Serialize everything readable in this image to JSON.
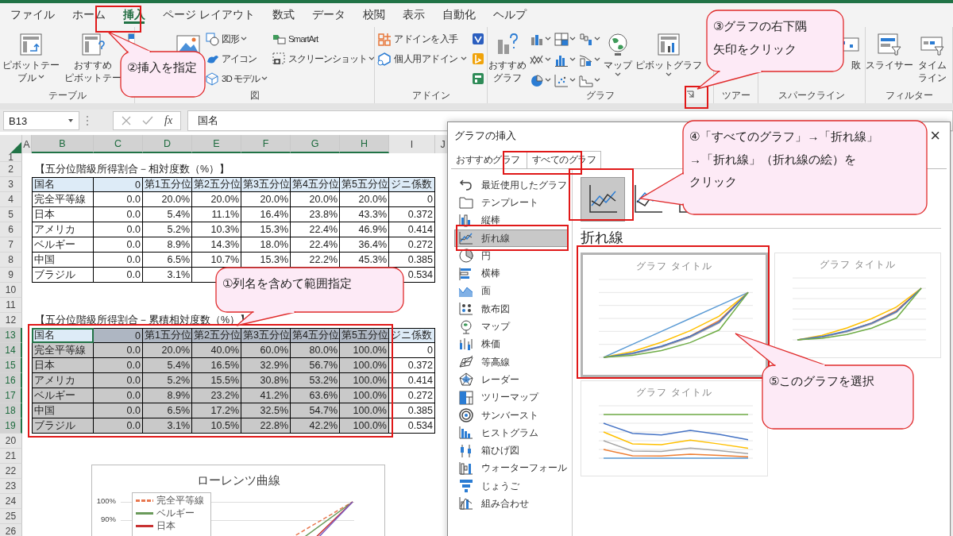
{
  "ribbon": {
    "tabs": [
      {
        "label": "ファイル",
        "selected": false
      },
      {
        "label": "ホーム",
        "selected": false
      },
      {
        "label": "挿入",
        "selected": true
      },
      {
        "label": "ページ レイアウト",
        "selected": false
      },
      {
        "label": "数式",
        "selected": false
      },
      {
        "label": "データ",
        "selected": false
      },
      {
        "label": "校閲",
        "selected": false
      },
      {
        "label": "表示",
        "selected": false
      },
      {
        "label": "自動化",
        "selected": false
      },
      {
        "label": "ヘルプ",
        "selected": false
      }
    ],
    "groups": [
      {
        "label": "テーブル",
        "launcher": false,
        "items": [
          {
            "kind": "large",
            "lines": [
              "ピボットテー",
              "ブル"
            ],
            "dropdown": true
          },
          {
            "kind": "large",
            "lines": [
              "おすすめ",
              "ピボットテー"
            ],
            "dropdown": false
          },
          {
            "kind": "large",
            "dropdown": false
          }
        ]
      },
      {
        "label": "図",
        "launcher": false,
        "items": [
          {
            "kind": "large",
            "dropdown": false
          },
          {
            "kind": "small",
            "label": "図形",
            "dropdown": true
          },
          {
            "kind": "small",
            "label": "アイコン",
            "dropdown": false
          },
          {
            "kind": "small",
            "label": "3D モデル",
            "dropdown": true
          },
          {
            "kind": "small",
            "label": "SmartArt",
            "dropdown": false
          },
          {
            "kind": "small",
            "label": "スクリーンショット",
            "dropdown": true
          }
        ]
      },
      {
        "label": "アドイン",
        "launcher": false,
        "items": [
          {
            "kind": "small",
            "label": "アドインを入手",
            "dropdown": false
          },
          {
            "kind": "small",
            "label": "個人用アドイン",
            "dropdown": true
          },
          {
            "kind": "icon",
            "dropdown": false
          },
          {
            "kind": "icon",
            "dropdown": false
          },
          {
            "kind": "icon",
            "dropdown": false
          }
        ]
      },
      {
        "label": "グラフ",
        "launcher": true,
        "items": [
          {
            "kind": "large",
            "lines": [
              "おすすめ",
              "グラフ"
            ],
            "dropdown": false
          },
          {
            "kind": "gallery",
            "dropdown": true
          },
          {
            "kind": "large",
            "label": "マップ",
            "dropdown": true
          },
          {
            "kind": "large",
            "label": "ピボットグラフ",
            "dropdown": true
          }
        ]
      },
      {
        "label": "ツアー",
        "launcher": false
      },
      {
        "label": "スパークライン",
        "launcher": false,
        "items": [
          {
            "kind": "large",
            "label": "敗",
            "dropdown": false
          }
        ]
      },
      {
        "label": "フィルター",
        "launcher": false,
        "items": [
          {
            "kind": "large",
            "label": "スライサー",
            "dropdown": false
          },
          {
            "kind": "large",
            "lines": [
              "タイム",
              "ライン"
            ],
            "dropdown": false
          }
        ]
      }
    ]
  },
  "formula_bar": {
    "name_box": "B13",
    "function_label": "fx",
    "value": "国名"
  },
  "sheet": {
    "columns": [
      {
        "label": "A",
        "selected": false
      },
      {
        "label": "B",
        "selected": true
      },
      {
        "label": "C",
        "selected": true
      },
      {
        "label": "D",
        "selected": true
      },
      {
        "label": "E",
        "selected": true
      },
      {
        "label": "F",
        "selected": true
      },
      {
        "label": "G",
        "selected": true
      },
      {
        "label": "H",
        "selected": true
      },
      {
        "label": "I",
        "selected": false
      },
      {
        "label": "J",
        "selected": false
      }
    ],
    "rows": [
      {
        "label": "1",
        "selected": false
      },
      {
        "label": "2",
        "selected": false
      },
      {
        "label": "3",
        "selected": false
      },
      {
        "label": "4",
        "selected": false
      },
      {
        "label": "5",
        "selected": false
      },
      {
        "label": "6",
        "selected": false
      },
      {
        "label": "7",
        "selected": false
      },
      {
        "label": "8",
        "selected": false
      },
      {
        "label": "9",
        "selected": false
      },
      {
        "label": "10",
        "selected": false
      },
      {
        "label": "11",
        "selected": false
      },
      {
        "label": "12",
        "selected": false
      },
      {
        "label": "13",
        "selected": true
      },
      {
        "label": "14",
        "selected": true
      },
      {
        "label": "15",
        "selected": true
      },
      {
        "label": "16",
        "selected": true
      },
      {
        "label": "17",
        "selected": true
      },
      {
        "label": "18",
        "selected": true
      },
      {
        "label": "19",
        "selected": true
      },
      {
        "label": "20",
        "selected": false
      },
      {
        "label": "21",
        "selected": false
      },
      {
        "label": "22",
        "selected": false
      },
      {
        "label": "23",
        "selected": false
      },
      {
        "label": "24",
        "selected": false
      },
      {
        "label": "25",
        "selected": false
      },
      {
        "label": "26",
        "selected": false
      }
    ],
    "tables": [
      {
        "title": "【五分位階級所得割合－相対度数（%）】",
        "columns": [
          {
            "header": "国名",
            "selected": false,
            "active": false
          },
          {
            "header": "0",
            "selected": false,
            "active": false
          },
          {
            "header": "第1五分位",
            "selected": false,
            "active": false
          },
          {
            "header": "第2五分位",
            "selected": false,
            "active": false
          },
          {
            "header": "第3五分位",
            "selected": false,
            "active": false
          },
          {
            "header": "第4五分位",
            "selected": false,
            "active": false
          },
          {
            "header": "第5五分位",
            "selected": false,
            "active": false
          },
          {
            "header": "ジニ係数",
            "selected": false,
            "active": false
          }
        ],
        "rows": [
          [
            "完全平等線",
            "0.0",
            "20.0%",
            "20.0%",
            "20.0%",
            "20.0%",
            "20.0%",
            "0"
          ],
          [
            "日本",
            "0.0",
            "5.4%",
            "11.1%",
            "16.4%",
            "23.8%",
            "43.3%",
            "0.372"
          ],
          [
            "アメリカ",
            "0.0",
            "5.2%",
            "10.3%",
            "15.3%",
            "22.4%",
            "46.9%",
            "0.414"
          ],
          [
            "ベルギー",
            "0.0",
            "8.9%",
            "14.3%",
            "18.0%",
            "22.4%",
            "36.4%",
            "0.272"
          ],
          [
            "中国",
            "0.0",
            "6.5%",
            "10.7%",
            "15.3%",
            "22.2%",
            "45.3%",
            "0.385"
          ],
          [
            "ブラジル",
            "0.0",
            "3.1%",
            null,
            null,
            null,
            null,
            "0.534"
          ]
        ]
      },
      {
        "title": "【五分位階級所得割合－累積相対度数（%）】",
        "columns": [
          {
            "header": "国名",
            "selected": true,
            "active": true
          },
          {
            "header": "0",
            "selected": true,
            "active": false
          },
          {
            "header": "第1五分位",
            "selected": true,
            "active": false
          },
          {
            "header": "第2五分位",
            "selected": true,
            "active": false
          },
          {
            "header": "第3五分位",
            "selected": true,
            "active": false
          },
          {
            "header": "第4五分位",
            "selected": true,
            "active": false
          },
          {
            "header": "第5五分位",
            "selected": true,
            "active": false
          },
          {
            "header": "ジニ係数",
            "selected": false,
            "active": false
          }
        ],
        "rows": [
          [
            "完全平等線",
            "0.0",
            "20.0%",
            "40.0%",
            "60.0%",
            "80.0%",
            "100.0%",
            "0"
          ],
          [
            "日本",
            "0.0",
            "5.4%",
            "16.5%",
            "32.9%",
            "56.7%",
            "100.0%",
            "0.372"
          ],
          [
            "アメリカ",
            "0.0",
            "5.2%",
            "15.5%",
            "30.8%",
            "53.2%",
            "100.0%",
            "0.414"
          ],
          [
            "ベルギー",
            "0.0",
            "8.9%",
            "23.2%",
            "41.2%",
            "63.6%",
            "100.0%",
            "0.272"
          ],
          [
            "中国",
            "0.0",
            "6.5%",
            "17.2%",
            "32.5%",
            "54.7%",
            "100.0%",
            "0.385"
          ],
          [
            "ブラジル",
            "0.0",
            "3.1%",
            "10.5%",
            "22.8%",
            "42.2%",
            "100.0%",
            "0.534"
          ]
        ]
      }
    ],
    "chart": {
      "title": "ローレンツ曲線",
      "y_labels": [
        "100%",
        "90%"
      ],
      "legend": [
        {
          "label": "完全平等線",
          "color": "#e8774f"
        },
        {
          "label": "ベルギー",
          "color": "#6a9a5a"
        },
        {
          "label": "日本",
          "color": "#c83232"
        }
      ]
    }
  },
  "dialog": {
    "title": "グラフの挿入",
    "close": "×",
    "tabs": [
      {
        "label": "おすすめグラフ",
        "selected": false
      },
      {
        "label": "すべてのグラフ",
        "selected": true
      }
    ],
    "chart_types": [
      {
        "label": "最近使用したグラフ",
        "selected": false
      },
      {
        "label": "テンプレート",
        "selected": false
      },
      {
        "label": "縦棒",
        "selected": false
      },
      {
        "label": "折れ線",
        "selected": true
      },
      {
        "label": "円",
        "selected": false
      },
      {
        "label": "横棒",
        "selected": false
      },
      {
        "label": "面",
        "selected": false
      },
      {
        "label": "散布図",
        "selected": false
      },
      {
        "label": "マップ",
        "selected": false
      },
      {
        "label": "株価",
        "selected": false
      },
      {
        "label": "等高線",
        "selected": false
      },
      {
        "label": "レーダー",
        "selected": false
      },
      {
        "label": "ツリーマップ",
        "selected": false
      },
      {
        "label": "サンバースト",
        "selected": false
      },
      {
        "label": "ヒストグラム",
        "selected": false
      },
      {
        "label": "箱ひげ図",
        "selected": false
      },
      {
        "label": "ウォーターフォール",
        "selected": false
      },
      {
        "label": "じょうご",
        "selected": false
      },
      {
        "label": "組み合わせ",
        "selected": false
      }
    ],
    "subtypes": [
      {
        "selected": true
      },
      {
        "selected": false
      },
      {
        "selected": false
      }
    ],
    "heading": "折れ線",
    "previews": [
      {
        "title": "グラフ タイトル",
        "selected": true
      },
      {
        "title": "グラフ タイトル",
        "selected": false
      },
      {
        "title": "グラフ タイトル",
        "selected": false
      }
    ]
  },
  "callouts": [
    {
      "lines": [
        "①列名を含めて範囲指定"
      ]
    },
    {
      "lines": [
        "②挿入を指定"
      ]
    },
    {
      "lines": [
        "③グラフの右下隅",
        "矢印をクリック"
      ]
    },
    {
      "lines": [
        "④「すべてのグラフ」→「折れ線」",
        "→「折れ線」（折れ線の絵）を",
        "クリック"
      ]
    },
    {
      "lines": [
        "⑤このグラフを選択"
      ]
    }
  ]
}
